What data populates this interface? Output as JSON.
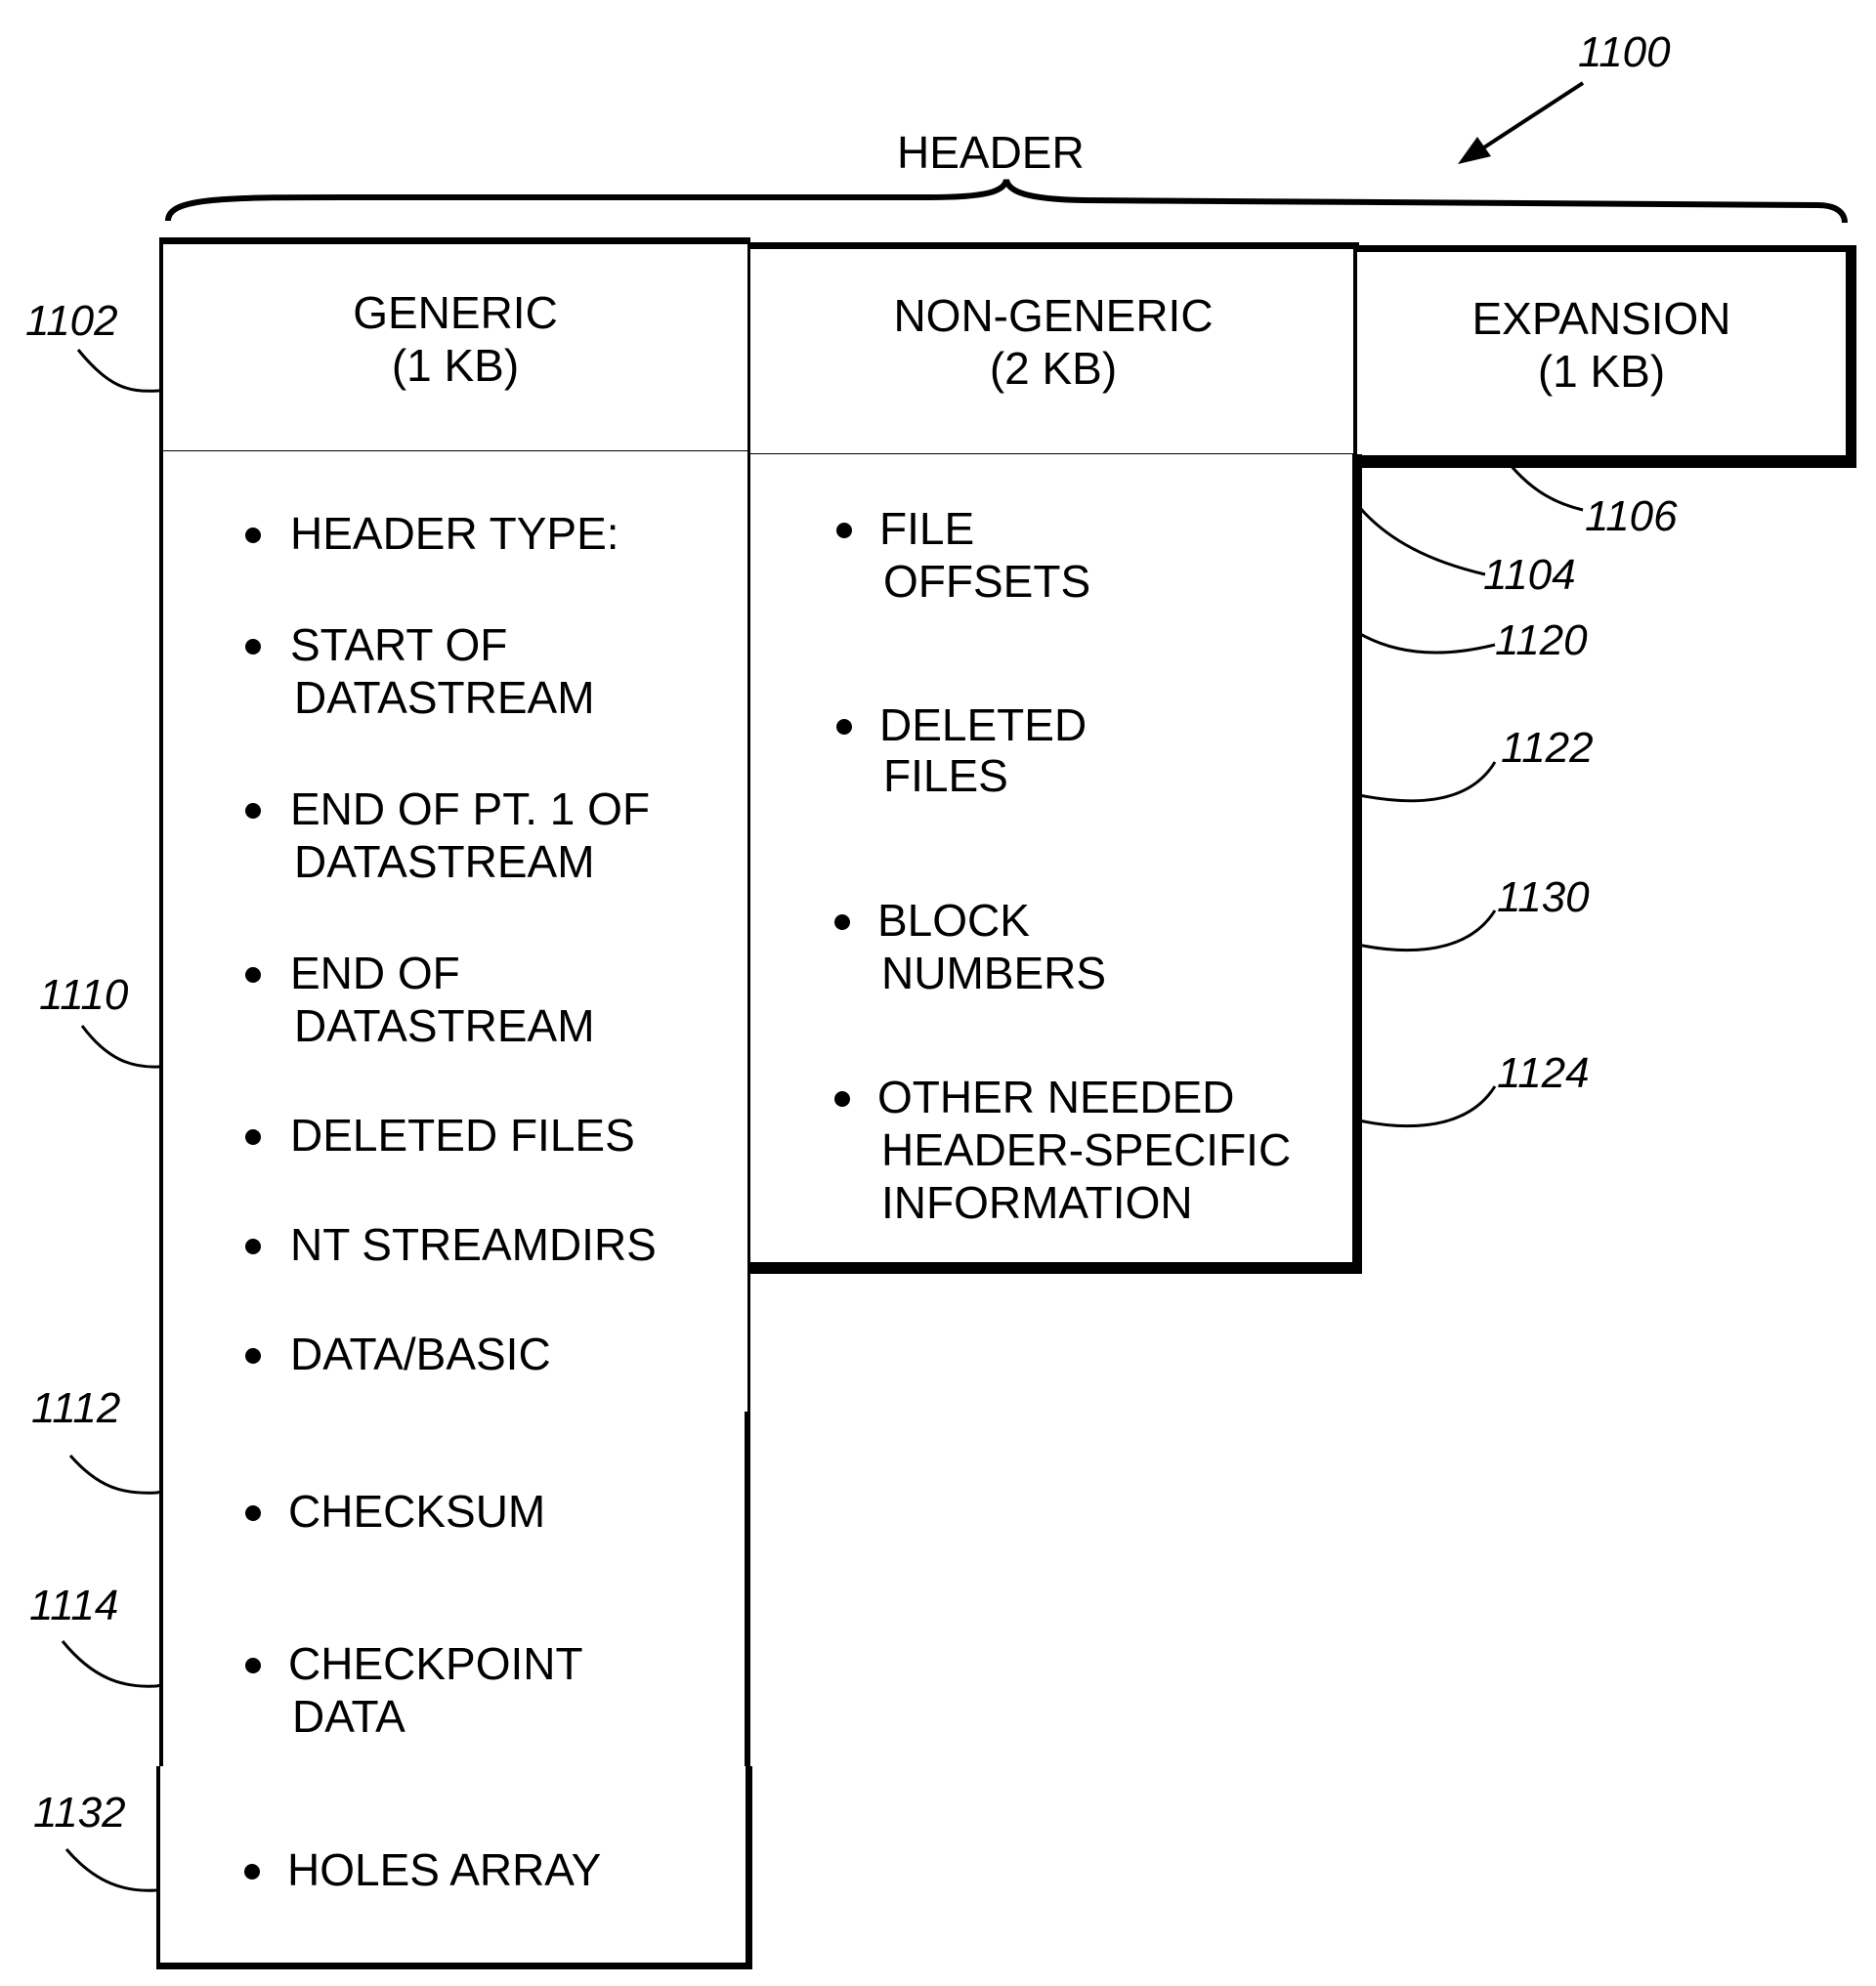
{
  "figure": {
    "ref": "1100",
    "brace_label": "HEADER"
  },
  "sections": {
    "generic": {
      "title": "GENERIC",
      "size": "(1 KB)",
      "ref": "1102"
    },
    "non_generic": {
      "title": "NON-GENERIC",
      "size": "(2 KB)",
      "ref": "1104"
    },
    "expansion": {
      "title": "EXPANSION",
      "size": "(1 KB)",
      "ref": "1106"
    }
  },
  "generic_blocks": [
    {
      "ref": "1110",
      "items": [
        {
          "lines": [
            "HEADER TYPE:"
          ]
        },
        {
          "lines": [
            "START OF",
            "DATASTREAM"
          ]
        },
        {
          "lines": [
            "END OF PT. 1 OF",
            "DATASTREAM"
          ]
        },
        {
          "lines": [
            "END OF",
            "DATASTREAM"
          ]
        },
        {
          "lines": [
            "DELETED FILES"
          ]
        },
        {
          "lines": [
            "NT STREAMDIRS"
          ]
        },
        {
          "lines": [
            "DATA/BASIC"
          ]
        }
      ]
    },
    {
      "ref": "1112",
      "items": [
        {
          "lines": [
            "CHECKSUM"
          ]
        }
      ]
    },
    {
      "ref": "1114",
      "items": [
        {
          "lines": [
            "CHECKPOINT",
            "DATA"
          ]
        }
      ]
    },
    {
      "ref": "1132",
      "items": [
        {
          "lines": [
            "HOLES ARRAY"
          ]
        }
      ]
    }
  ],
  "non_generic_blocks": [
    {
      "ref": "1120",
      "lines": [
        "FILE",
        "OFFSETS"
      ]
    },
    {
      "ref": "1122",
      "lines": [
        "DELETED",
        "FILES"
      ]
    },
    {
      "ref": "1130",
      "lines": [
        "BLOCK",
        "NUMBERS"
      ]
    },
    {
      "ref": "1124",
      "lines": [
        "OTHER NEEDED",
        "HEADER-SPECIFIC",
        "INFORMATION"
      ]
    }
  ]
}
